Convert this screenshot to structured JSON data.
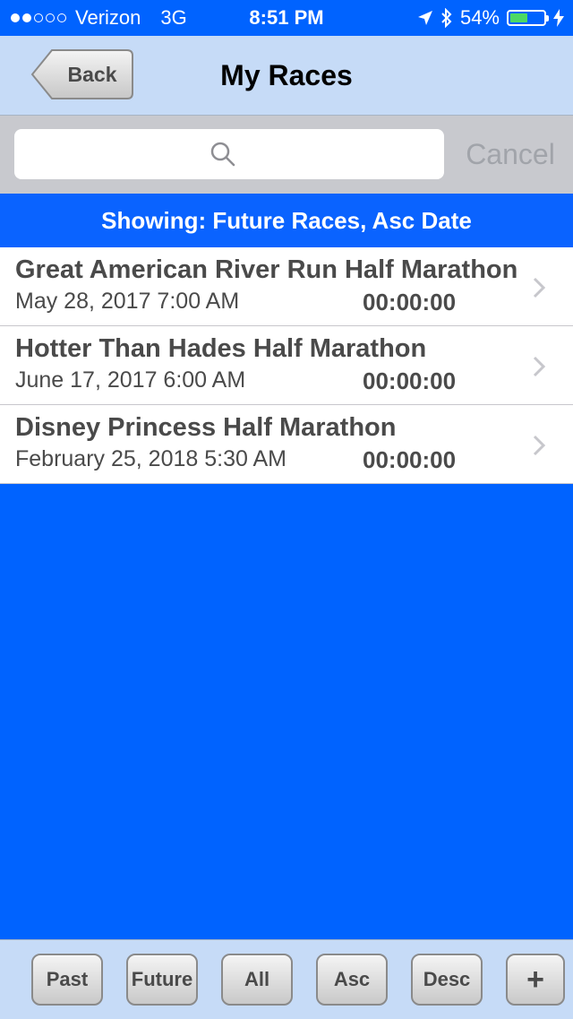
{
  "status_bar": {
    "carrier": "Verizon",
    "network": "3G",
    "time": "8:51 PM",
    "battery": "54%",
    "battery_level": 0.54
  },
  "nav": {
    "back_label": "Back",
    "title": "My Races"
  },
  "search": {
    "placeholder": "",
    "cancel_label": "Cancel"
  },
  "filter": {
    "text": "Showing: Future Races, Asc Date"
  },
  "races": [
    {
      "name": "Great American River Run Half Marathon",
      "date": "May 28, 2017  7:00 AM",
      "time": "00:00:00"
    },
    {
      "name": "Hotter Than Hades Half Marathon",
      "date": "June 17, 2017  6:00 AM",
      "time": "00:00:00"
    },
    {
      "name": "Disney Princess Half Marathon",
      "date": "February 25, 2018  5:30 AM",
      "time": "00:00:00"
    }
  ],
  "toolbar": {
    "past": "Past",
    "future": "Future",
    "all": "All",
    "asc": "Asc",
    "desc": "Desc",
    "add": "+"
  },
  "colors": {
    "accent_blue": "#0063ff",
    "nav_background": "#c6dbf7",
    "text_gray": "#4a4a4a"
  }
}
